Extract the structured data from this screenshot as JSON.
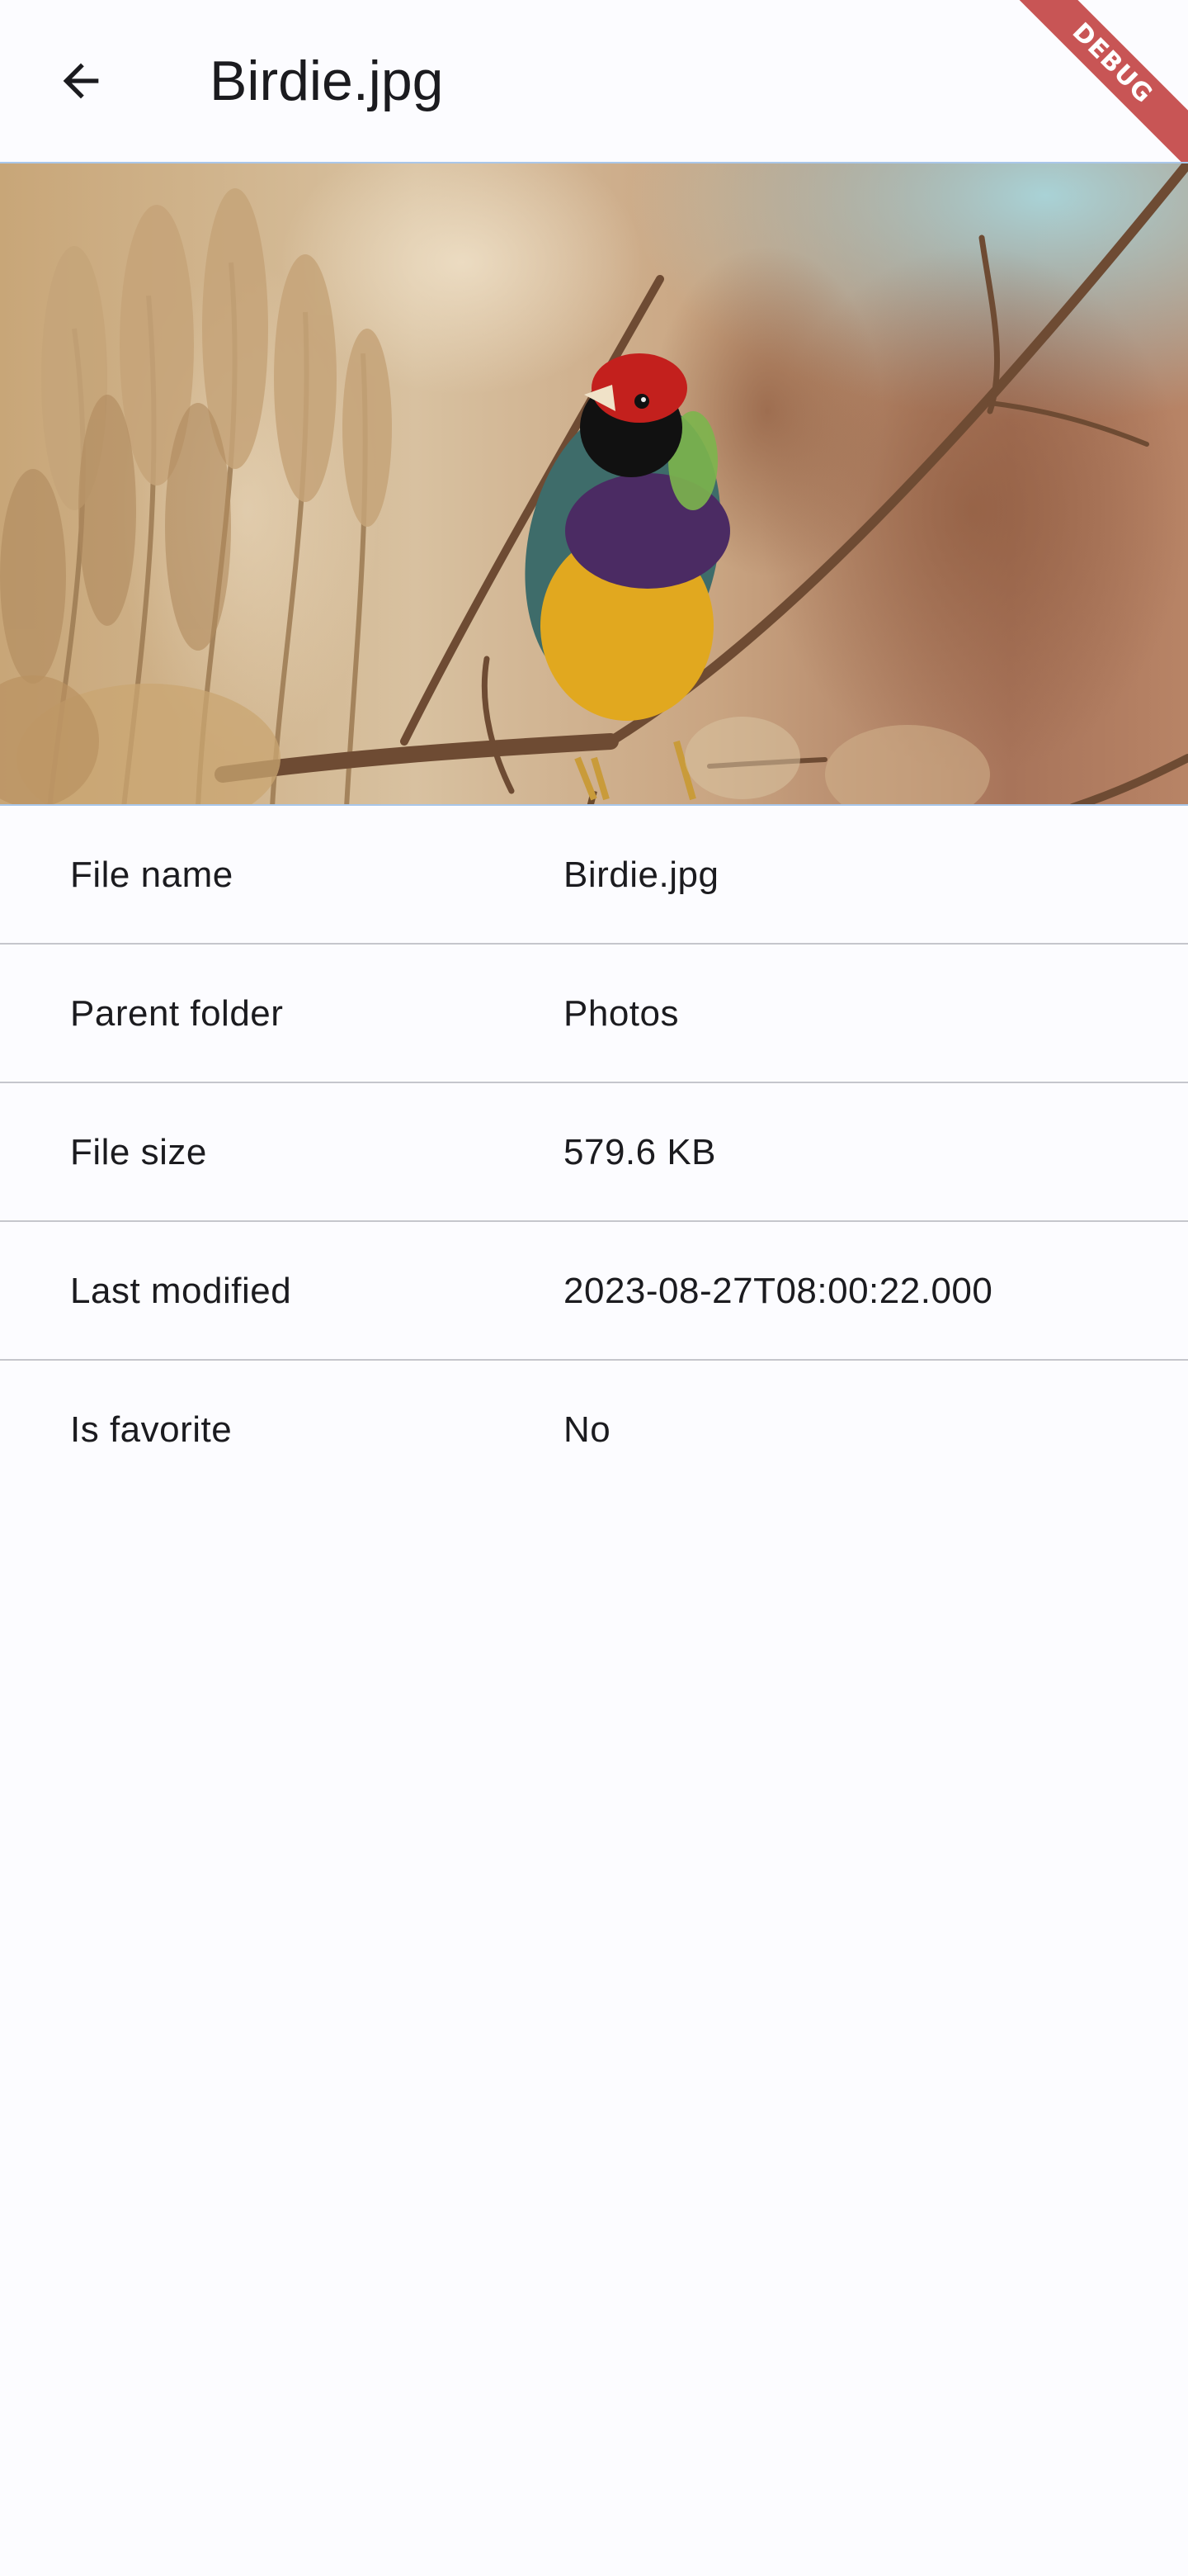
{
  "app_bar": {
    "title": "Birdie.jpg",
    "back_icon": "arrow-back-icon"
  },
  "debug_banner": {
    "label": "DEBUG",
    "color": "#B82525"
  },
  "image": {
    "subject": "bird-photo",
    "border_color": "#A9C7EA"
  },
  "details": [
    {
      "label": "File name",
      "value": "Birdie.jpg"
    },
    {
      "label": "Parent folder",
      "value": "Photos"
    },
    {
      "label": "File size",
      "value": "579.6 KB"
    },
    {
      "label": "Last modified",
      "value": "2023-08-27T08:00:22.000"
    },
    {
      "label": "Is favorite",
      "value": "No"
    }
  ],
  "colors": {
    "background": "#FCFCFF",
    "text": "#1B1B1F",
    "divider": "#C5C6CC"
  }
}
